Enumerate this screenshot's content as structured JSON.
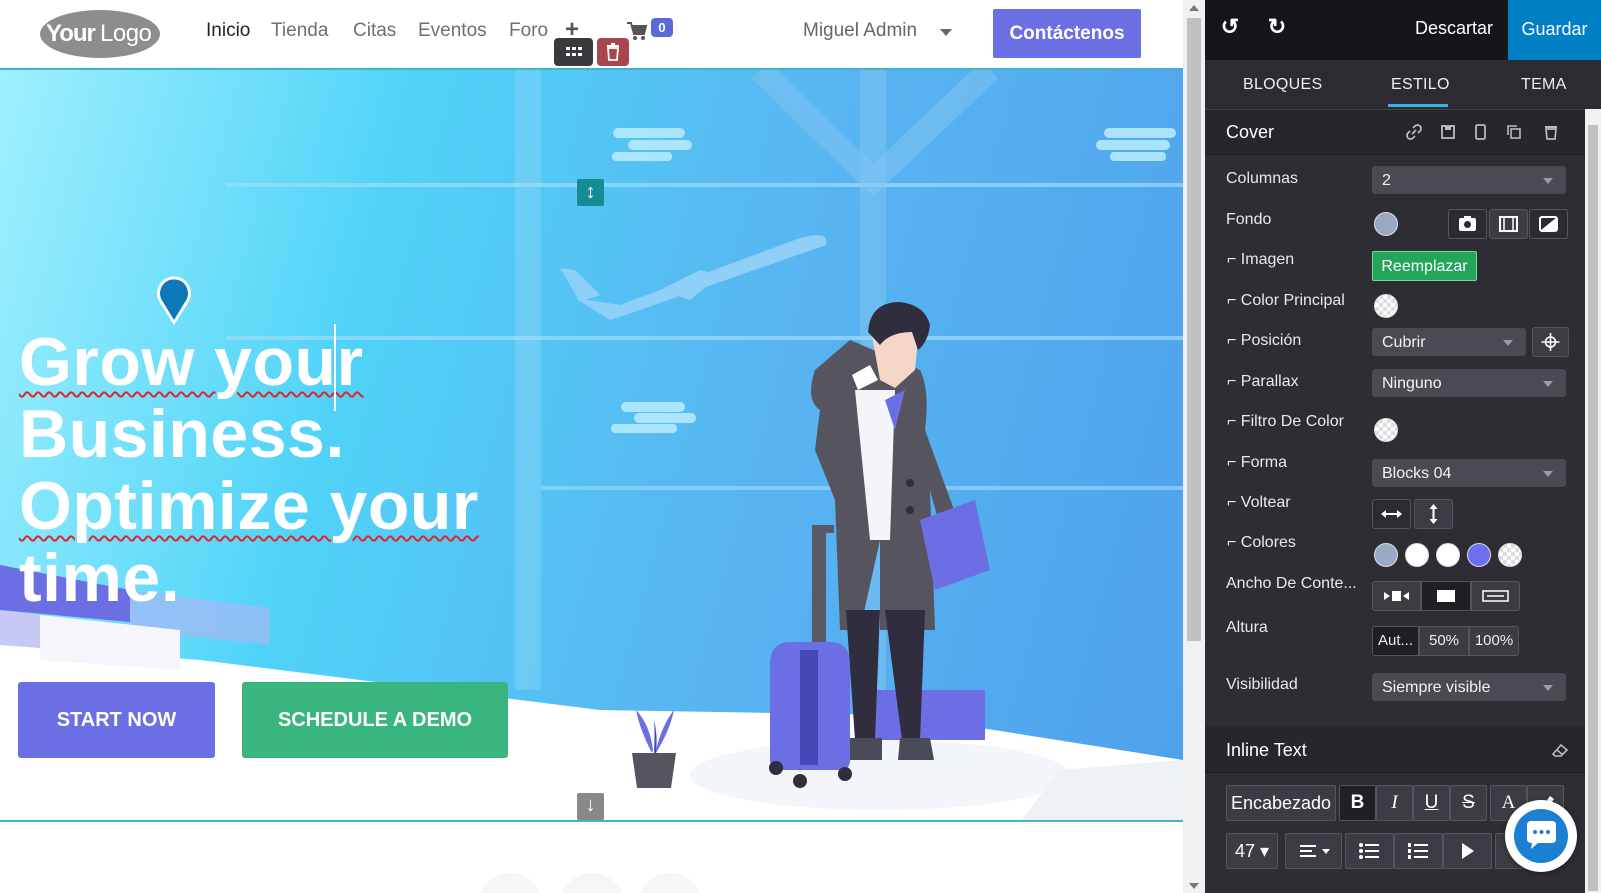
{
  "site": {
    "logo_text": "YourLogo",
    "nav": [
      {
        "label": "Inicio",
        "active": true
      },
      {
        "label": "Tienda"
      },
      {
        "label": "Citas"
      },
      {
        "label": "Eventos"
      },
      {
        "label": "Foro"
      }
    ],
    "cart_count": "0",
    "user_name": "Miguel Admin",
    "contact_button": "Contáctenos",
    "hero": {
      "headline_words": [
        "Grow your",
        "Business.",
        "Optimize your",
        "time."
      ],
      "start_button": "START NOW",
      "demo_button": "SCHEDULE A DEMO"
    }
  },
  "panel": {
    "discard": "Descartar",
    "save": "Guardar",
    "tabs": [
      "BLOQUES",
      "ESTILO",
      "TEMA"
    ],
    "active_tab": "ESTILO",
    "cover_section": {
      "title": "Cover",
      "rows": {
        "columns_label": "Columnas",
        "columns_value": "2",
        "background_label": "Fondo",
        "image_label": "Imagen",
        "image_button": "Reemplazar",
        "main_color_label": "Color Principal",
        "position_label": "Posición",
        "position_value": "Cubrir",
        "parallax_label": "Parallax",
        "parallax_value": "Ninguno",
        "color_filter_label": "Filtro De Color",
        "shape_label": "Forma",
        "shape_value": "Blocks 04",
        "flip_label": "Voltear",
        "colors_label": "Colores",
        "content_width_label": "Ancho De Conte...",
        "height_label": "Altura",
        "height_options": [
          "Aut...",
          "50%",
          "100%"
        ],
        "visibility_label": "Visibilidad",
        "visibility_value": "Siempre visible"
      },
      "colors": {
        "background_swatch": "#9aa9c6",
        "palette": [
          "#9aa9c6",
          "#ffffff",
          "#ffffff",
          "#6c6ff0",
          "checker"
        ]
      }
    },
    "inline_text_section": {
      "title": "Inline Text",
      "style_select": "Encabezado",
      "font_size": "47"
    }
  },
  "colors": {
    "accent_purple": "#6b6fe3",
    "accent_green": "#39b57e",
    "save_blue": "#017fc5",
    "panel_bg": "#2d2d33"
  }
}
